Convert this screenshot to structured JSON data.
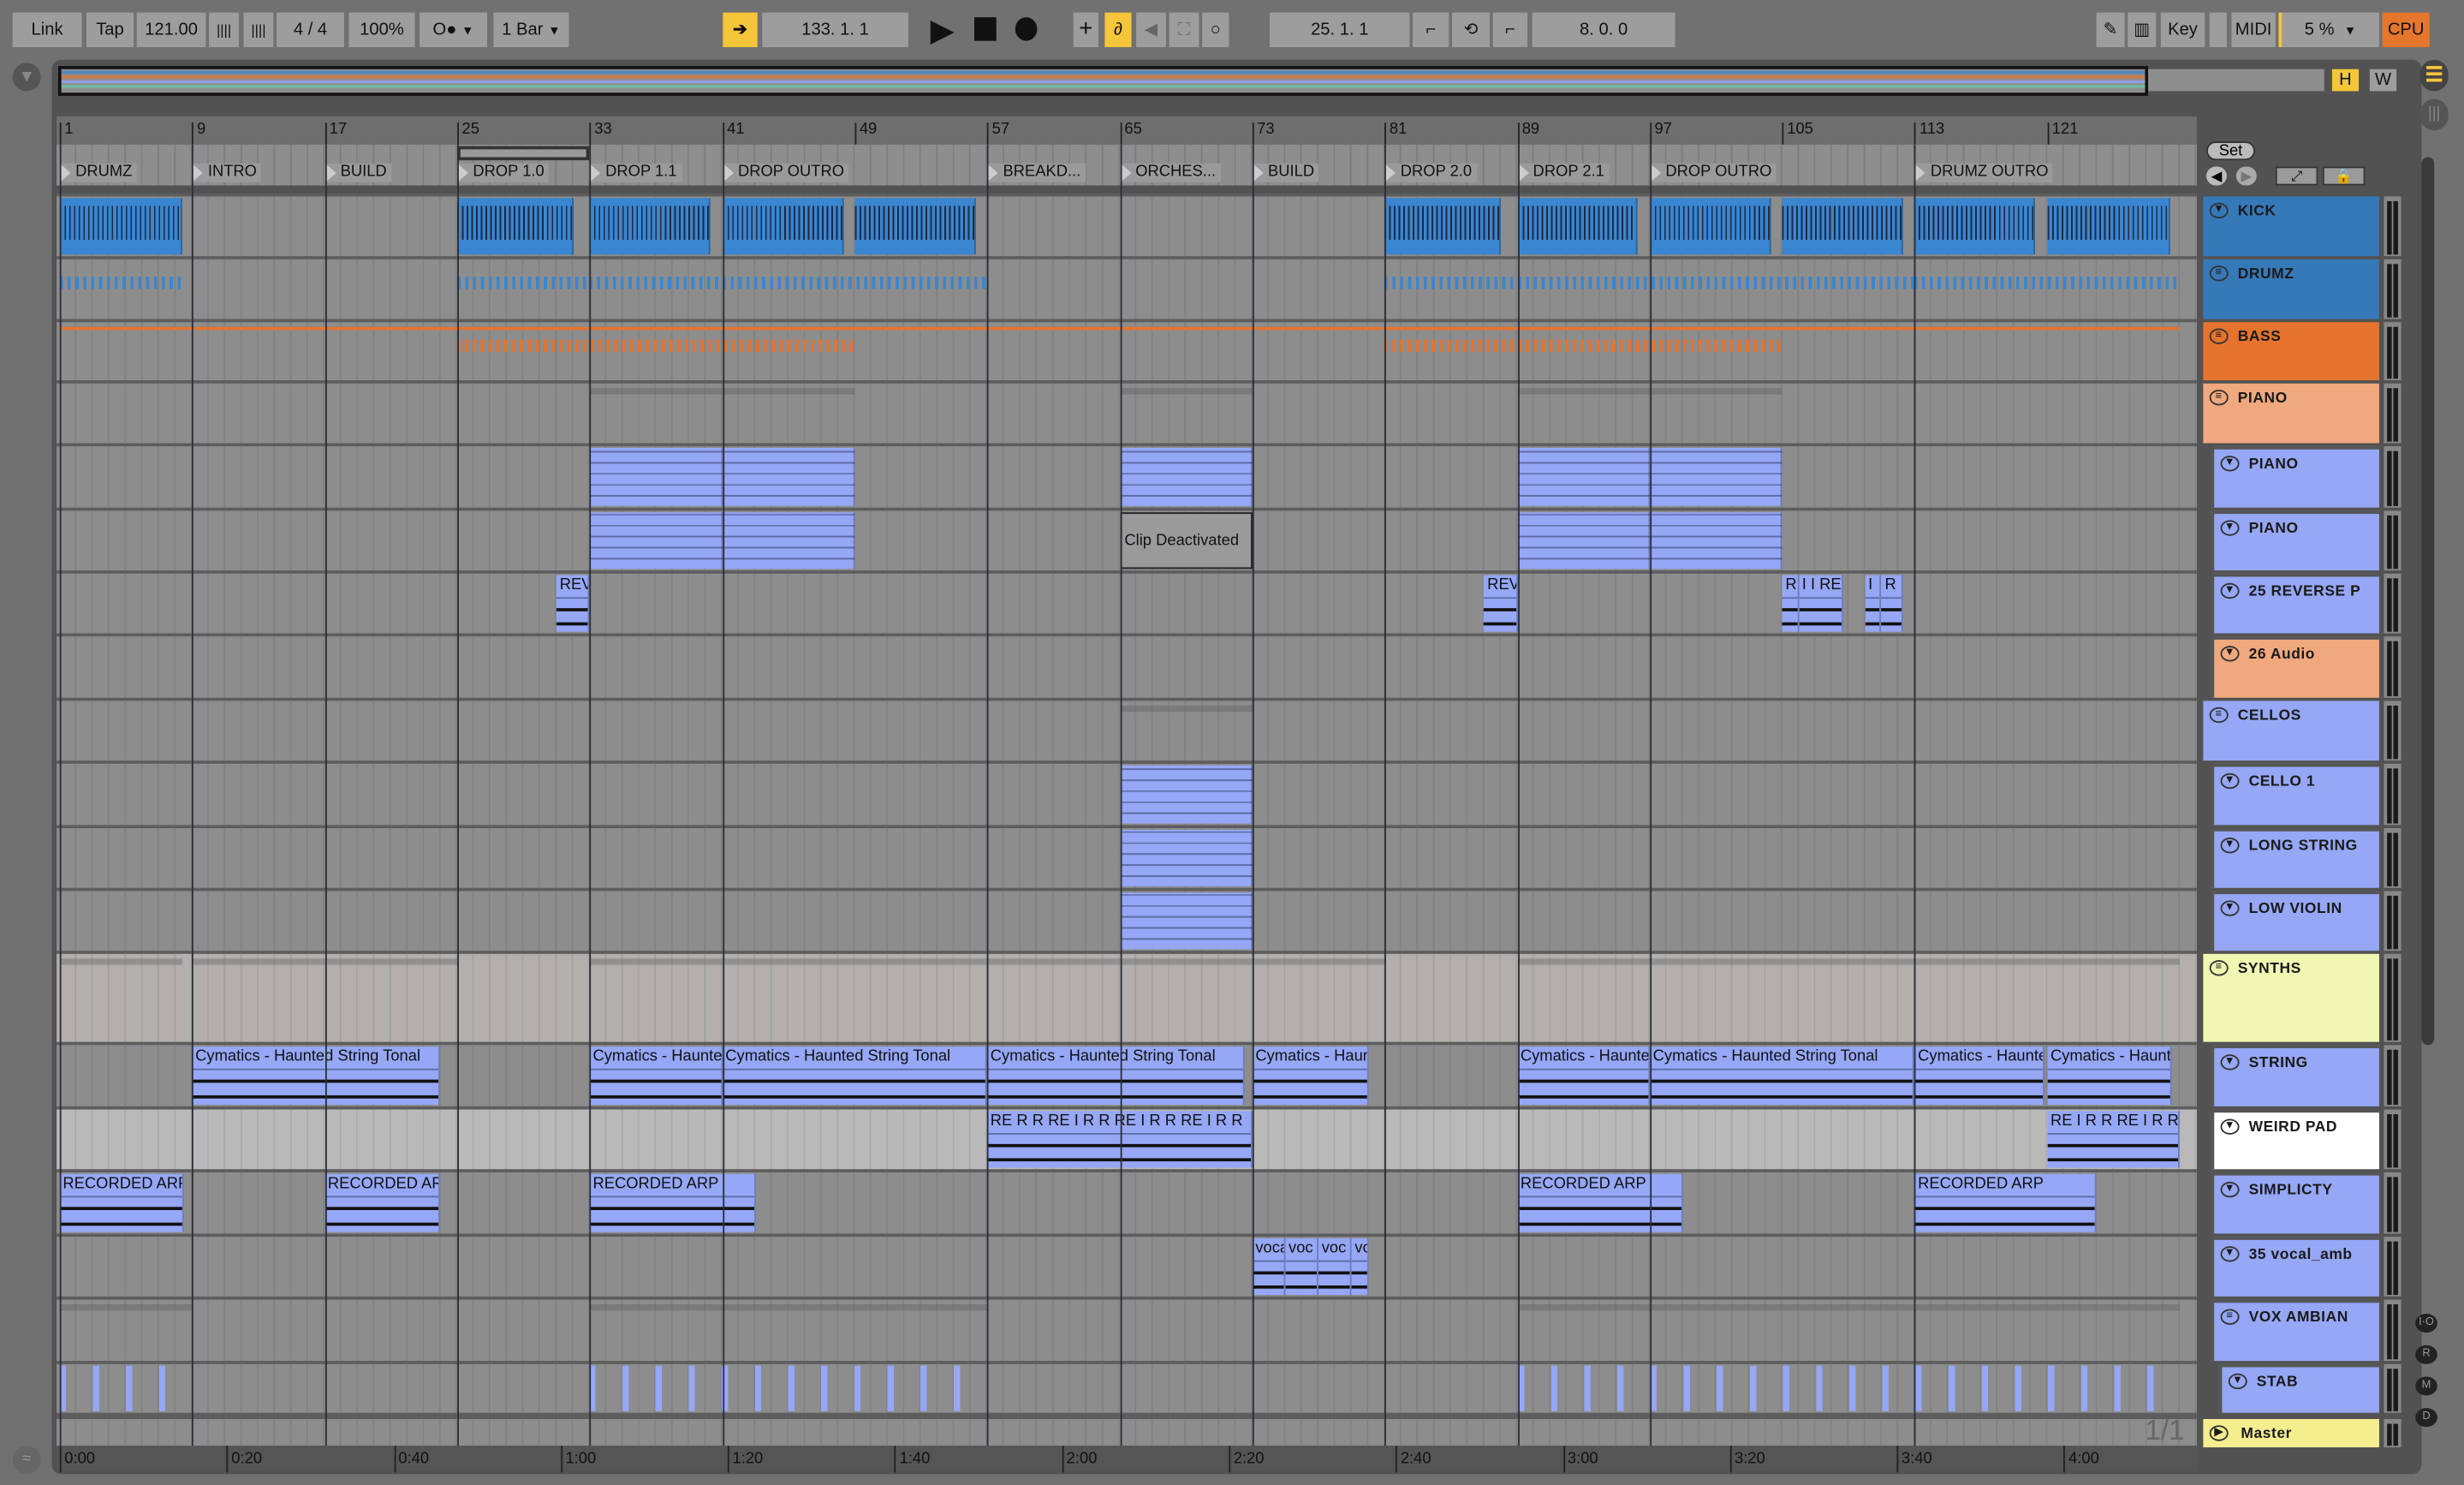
{
  "transport": {
    "link": "Link",
    "tap": "Tap",
    "tempo": "121.00",
    "metronome_a": "||||",
    "metronome_b": "||||",
    "time_signature": "4 / 4",
    "groove_amount": "100%",
    "automation_mode": "O●",
    "quantize": "1 Bar",
    "follow_icon": "follow-arrow-icon",
    "song_position": "133.  1.  1",
    "play": "▶",
    "stop": "■",
    "record": "●",
    "loop_start": "25.  1.  1",
    "loop_length": "8.  0.  0",
    "key": "Key",
    "midi": "MIDI",
    "cpu_percent": "5 %",
    "cpu": "CPU"
  },
  "overview": {
    "h": "H",
    "w": "W"
  },
  "ruler_bars": [
    "1",
    "9",
    "17",
    "25",
    "33",
    "41",
    "49",
    "57",
    "65",
    "73",
    "81",
    "89",
    "97",
    "105",
    "113",
    "121"
  ],
  "locators": [
    {
      "name": "DRUMZ",
      "bar": 1
    },
    {
      "name": "INTRO",
      "bar": 9
    },
    {
      "name": "BUILD",
      "bar": 17
    },
    {
      "name": "DROP 1.0",
      "bar": 25
    },
    {
      "name": "DROP 1.1",
      "bar": 33
    },
    {
      "name": "DROP OUTRO",
      "bar": 41
    },
    {
      "name": "BREAKD...",
      "bar": 57
    },
    {
      "name": "ORCHES...",
      "bar": 65
    },
    {
      "name": "BUILD",
      "bar": 73
    },
    {
      "name": "DROP 2.0",
      "bar": 81
    },
    {
      "name": "DROP 2.1",
      "bar": 89
    },
    {
      "name": "DROP OUTRO",
      "bar": 97
    },
    {
      "name": "DRUMZ OUTRO",
      "bar": 113
    }
  ],
  "loop": {
    "start": 25,
    "end": 33
  },
  "set_button": "Set",
  "colors": {
    "blue": "#3679b9",
    "orange": "#e5732e",
    "peach": "#f0a87e",
    "lavender": "#95a7f5",
    "lightyellow": "#f0f7b2",
    "white": "#ffffff",
    "master": "#f5ee8f",
    "accent": "#f5c53a",
    "cpu": "#e5762c"
  },
  "tracks": [
    {
      "name": "KICK",
      "color": "#3679b9",
      "icon": "fold",
      "level": 0,
      "lane": "normal",
      "clips": [
        {
          "s": 1,
          "e": 8.4,
          "t": "midi"
        },
        {
          "s": 25,
          "e": 32,
          "t": "midi"
        },
        {
          "s": 33,
          "e": 40.3,
          "t": "midi"
        },
        {
          "s": 41,
          "e": 48.3,
          "t": "midi"
        },
        {
          "s": 49,
          "e": 56.3,
          "t": "midi"
        },
        {
          "s": 81,
          "e": 88,
          "t": "midi"
        },
        {
          "s": 89,
          "e": 96.3,
          "t": "midi"
        },
        {
          "s": 97,
          "e": 104.3,
          "t": "midi"
        },
        {
          "s": 105,
          "e": 112.3,
          "t": "midi"
        },
        {
          "s": 113,
          "e": 120.3,
          "t": "midi"
        },
        {
          "s": 121,
          "e": 128.4,
          "t": "midi"
        }
      ]
    },
    {
      "name": "DRUMZ",
      "color": "#3679b9",
      "icon": "group",
      "level": 0,
      "lane": "normal",
      "clips": [
        {
          "s": 1,
          "e": 8.4,
          "t": "notes",
          "c": "#3a86d0"
        },
        {
          "s": 25,
          "e": 33,
          "t": "notes",
          "c": "#3a86d0"
        },
        {
          "s": 33,
          "e": 57,
          "t": "notes",
          "c": "#3a86d0"
        },
        {
          "s": 81,
          "e": 89,
          "t": "notes",
          "c": "#3a86d0"
        },
        {
          "s": 89,
          "e": 113,
          "t": "notes",
          "c": "#3a86d0"
        },
        {
          "s": 113,
          "e": 129,
          "t": "notes",
          "c": "#3a86d0"
        }
      ]
    },
    {
      "name": "BASS",
      "color": "#e5732e",
      "icon": "group",
      "level": 0,
      "lane": "normal",
      "clips": [
        {
          "s": 1,
          "e": 129,
          "t": "line",
          "c": "#e5732e"
        },
        {
          "s": 25,
          "e": 49,
          "t": "notes",
          "c": "#e5732e"
        },
        {
          "s": 81,
          "e": 105,
          "t": "notes",
          "c": "#e5732e"
        }
      ]
    },
    {
      "name": "PIANO",
      "color": "#f0a87e",
      "icon": "group",
      "level": 0,
      "lane": "normal",
      "clips": [
        {
          "s": 33,
          "e": 49,
          "t": "summary"
        },
        {
          "s": 65,
          "e": 73,
          "t": "summary"
        },
        {
          "s": 89,
          "e": 105,
          "t": "summary"
        }
      ]
    },
    {
      "name": "PIANO",
      "color": "#95a7f5",
      "icon": "fold",
      "level": 1,
      "lane": "normal",
      "clips": [
        {
          "s": 33,
          "e": 41,
          "t": "midi2"
        },
        {
          "s": 41,
          "e": 49,
          "t": "midi2"
        },
        {
          "s": 65,
          "e": 73,
          "t": "midi2"
        },
        {
          "s": 89,
          "e": 97,
          "t": "midi2"
        },
        {
          "s": 97,
          "e": 105,
          "t": "midi2"
        }
      ]
    },
    {
      "name": "PIANO",
      "color": "#95a7f5",
      "icon": "fold",
      "level": 1,
      "lane": "normal",
      "clips": [
        {
          "s": 33,
          "e": 41,
          "t": "midi2"
        },
        {
          "s": 41,
          "e": 49,
          "t": "midi2"
        },
        {
          "s": 65,
          "e": 73,
          "t": "deactivated",
          "label": "Clip Deactivated"
        },
        {
          "s": 89,
          "e": 97,
          "t": "midi2"
        },
        {
          "s": 97,
          "e": 105,
          "t": "midi2"
        }
      ]
    },
    {
      "name": "25 REVERSE P",
      "color": "#95a7f5",
      "icon": "fold",
      "level": 1,
      "lane": "normal",
      "clips": [
        {
          "s": 31,
          "e": 33,
          "t": "audio",
          "label": "REV"
        },
        {
          "s": 87,
          "e": 89,
          "t": "audio",
          "label": "REV"
        },
        {
          "s": 105,
          "e": 106,
          "t": "audio",
          "label": "R"
        },
        {
          "s": 106,
          "e": 108.7,
          "t": "audio",
          "label": "I I RE R"
        },
        {
          "s": 110,
          "e": 111,
          "t": "audio",
          "label": "I"
        },
        {
          "s": 111,
          "e": 112.3,
          "t": "audio",
          "label": "R"
        }
      ]
    },
    {
      "name": "26 Audio",
      "color": "#f0a87e",
      "icon": "fold",
      "level": 1,
      "lane": "normal",
      "clips": []
    },
    {
      "name": "CELLOS",
      "color": "#95a7f5",
      "icon": "group",
      "level": 0,
      "lane": "normal",
      "clips": [
        {
          "s": 65,
          "e": 73,
          "t": "summary"
        }
      ]
    },
    {
      "name": "CELLO 1",
      "color": "#95a7f5",
      "icon": "fold",
      "level": 1,
      "lane": "normal",
      "clips": [
        {
          "s": 65,
          "e": 73,
          "t": "midi2"
        }
      ]
    },
    {
      "name": "LONG STRING",
      "color": "#95a7f5",
      "icon": "fold",
      "level": 1,
      "lane": "normal",
      "clips": [
        {
          "s": 65,
          "e": 73,
          "t": "midi2"
        }
      ]
    },
    {
      "name": "LOW VIOLIN",
      "color": "#95a7f5",
      "icon": "fold",
      "level": 1,
      "lane": "normal",
      "clips": [
        {
          "s": 65,
          "e": 73,
          "t": "midi2"
        }
      ]
    },
    {
      "name": "SYNTHS",
      "color": "#f0f7b2",
      "icon": "group",
      "level": 0,
      "lane": "light",
      "clips": [
        {
          "s": 1,
          "e": 8.4,
          "t": "summary"
        },
        {
          "s": 9,
          "e": 25,
          "t": "summary"
        },
        {
          "s": 33,
          "e": 73,
          "t": "summary"
        },
        {
          "s": 73,
          "e": 81,
          "t": "summary"
        },
        {
          "s": 89,
          "e": 129,
          "t": "summary"
        }
      ]
    },
    {
      "name": "STRING",
      "color": "#95a7f5",
      "icon": "fold",
      "level": 1,
      "lane": "normal",
      "clips": [
        {
          "s": 9,
          "e": 24,
          "t": "audio",
          "label": "Cymatics - Haunted String Tonal"
        },
        {
          "s": 33,
          "e": 41,
          "t": "audio",
          "label": "Cymatics - Haunted"
        },
        {
          "s": 41,
          "e": 57,
          "t": "audio",
          "label": "Cymatics - Haunted String Tonal"
        },
        {
          "s": 57,
          "e": 72.5,
          "t": "audio",
          "label": "Cymatics - Haunted String Tonal"
        },
        {
          "s": 73,
          "e": 80,
          "t": "audio",
          "label": "Cymatics - Haunted"
        },
        {
          "s": 89,
          "e": 97,
          "t": "audio",
          "label": "Cymatics - Haunted"
        },
        {
          "s": 97,
          "e": 113,
          "t": "audio",
          "label": "Cymatics - Haunted String Tonal"
        },
        {
          "s": 113,
          "e": 120.8,
          "t": "audio",
          "label": "Cymatics - Haunted"
        },
        {
          "s": 121,
          "e": 128.5,
          "t": "audio",
          "label": "Cymatics - Haunted"
        }
      ]
    },
    {
      "name": "WEIRD PAD",
      "color": "#ffffff",
      "icon": "fold",
      "level": 1,
      "lane": "selected",
      "clips": [
        {
          "s": 57,
          "e": 73,
          "t": "audio",
          "label": "RE  R  R  RE  I R  R  RE  I R  R  RE  I R  R"
        },
        {
          "s": 121,
          "e": 129,
          "t": "audio",
          "label": "RE I R R RE I R R"
        }
      ]
    },
    {
      "name": "SIMPLICTY",
      "color": "#95a7f5",
      "icon": "fold",
      "level": 1,
      "lane": "normal",
      "clips": [
        {
          "s": 1,
          "e": 8.5,
          "t": "audio",
          "label": "RECORDED ARP"
        },
        {
          "s": 17,
          "e": 24,
          "t": "audio",
          "label": "RECORDED ARP"
        },
        {
          "s": 33,
          "e": 43,
          "t": "audio",
          "label": "RECORDED ARP"
        },
        {
          "s": 89,
          "e": 99,
          "t": "audio",
          "label": "RECORDED ARP"
        },
        {
          "s": 113,
          "e": 124,
          "t": "audio",
          "label": "RECORDED ARP"
        }
      ]
    },
    {
      "name": "35 vocal_amb",
      "color": "#95a7f5",
      "icon": "fold",
      "level": 1,
      "lane": "normal",
      "clips": [
        {
          "s": 73,
          "e": 75,
          "t": "audio",
          "label": "voca"
        },
        {
          "s": 75,
          "e": 77,
          "t": "audio",
          "label": "voc"
        },
        {
          "s": 77,
          "e": 79,
          "t": "audio",
          "label": "voc"
        },
        {
          "s": 79,
          "e": 80,
          "t": "audio",
          "label": "vo"
        }
      ]
    },
    {
      "name": "VOX AMBIAN",
      "color": "#95a7f5",
      "icon": "group",
      "level": 1,
      "lane": "normal",
      "clips": [
        {
          "s": 1,
          "e": 9,
          "t": "summary"
        },
        {
          "s": 33,
          "e": 57,
          "t": "summary"
        },
        {
          "s": 89,
          "e": 129,
          "t": "summary"
        }
      ]
    },
    {
      "name": "STAB",
      "color": "#95a7f5",
      "icon": "fold",
      "level": 2,
      "lane": "normal",
      "clips": [
        {
          "s": 1,
          "e": 7.7,
          "t": "stabs"
        },
        {
          "s": 33,
          "e": 55.7,
          "t": "stabs"
        },
        {
          "s": 89,
          "e": 127.7,
          "t": "stabs"
        }
      ]
    },
    {
      "name": "Master",
      "color": "#f5ee8f",
      "icon": "play",
      "level": 0,
      "lane": "normal",
      "clips": []
    }
  ],
  "time_ruler": [
    {
      "label": "0:00",
      "seconds": 0
    },
    {
      "label": "0:20",
      "seconds": 20
    },
    {
      "label": "0:40",
      "seconds": 40
    },
    {
      "label": "1:00",
      "seconds": 60
    },
    {
      "label": "1:20",
      "seconds": 80
    },
    {
      "label": "1:40",
      "seconds": 100
    },
    {
      "label": "2:00",
      "seconds": 120
    },
    {
      "label": "2:20",
      "seconds": 140
    },
    {
      "label": "2:40",
      "seconds": 160
    },
    {
      "label": "3:00",
      "seconds": 180
    },
    {
      "label": "3:20",
      "seconds": 200
    },
    {
      "label": "3:40",
      "seconds": 220
    },
    {
      "label": "4:00",
      "seconds": 240
    }
  ],
  "tempo_bpm": 121,
  "page_indicator": "1/1",
  "side_buttons": [
    "I·O",
    "R",
    "M",
    "D"
  ]
}
